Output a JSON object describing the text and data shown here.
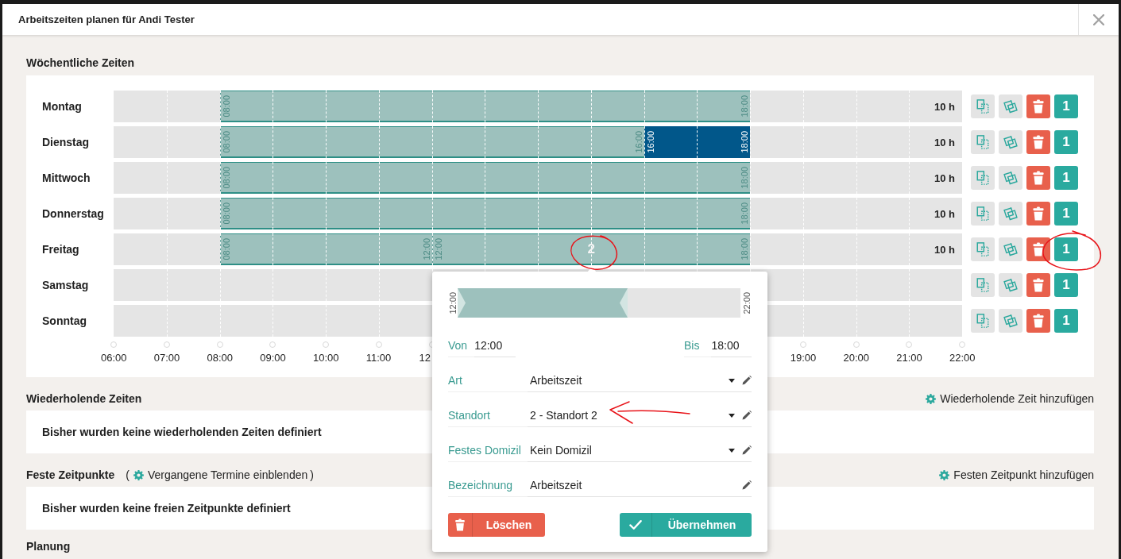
{
  "dialog": {
    "title": "Arbeitszeiten planen für Andi Tester"
  },
  "weekly": {
    "title": "Wöchentliche Zeiten",
    "days": [
      {
        "name": "Montag",
        "total": "10 h",
        "count": "1",
        "segments": [
          {
            "start": "08:00",
            "end": "18:00",
            "color": "#9dc1bd"
          }
        ]
      },
      {
        "name": "Dienstag",
        "total": "10 h",
        "count": "1",
        "segments": [
          {
            "start": "08:00",
            "end": "16:00",
            "color": "#9dc1bd"
          },
          {
            "start": "16:00",
            "end": "18:00",
            "color": "#01578a"
          }
        ]
      },
      {
        "name": "Mittwoch",
        "total": "10 h",
        "count": "1",
        "segments": [
          {
            "start": "08:00",
            "end": "18:00",
            "color": "#9dc1bd"
          }
        ]
      },
      {
        "name": "Donnerstag",
        "total": "10 h",
        "count": "1",
        "segments": [
          {
            "start": "08:00",
            "end": "18:00",
            "color": "#9dc1bd"
          }
        ]
      },
      {
        "name": "Freitag",
        "total": "10 h",
        "count": "1",
        "segments": [
          {
            "start": "08:00",
            "end": "12:00",
            "color": "#9dc1bd"
          },
          {
            "start": "12:00",
            "end": "18:00",
            "color": "#9dc1bd",
            "badge": "2"
          }
        ]
      },
      {
        "name": "Samstag",
        "count": "1"
      },
      {
        "name": "Sonntag",
        "count": "1"
      }
    ],
    "axis": [
      "06:00",
      "07:00",
      "08:00",
      "09:00",
      "10:00",
      "11:00",
      "12",
      "19:00",
      "20:00",
      "21:00",
      "22:00"
    ]
  },
  "popup": {
    "range": {
      "start": "12:00",
      "end": "22:00",
      "level": 0.6
    },
    "from": {
      "label": "Von",
      "value": "12:00"
    },
    "to": {
      "label": "Bis",
      "value": "18:00"
    },
    "fields": [
      {
        "label": "Art",
        "value": "Arbeitszeit",
        "kind": "select"
      },
      {
        "label": "Standort",
        "value": "2 - Standort 2",
        "kind": "select"
      },
      {
        "label": "Festes Domizil",
        "value": "Kein Domizil",
        "kind": "select"
      },
      {
        "label": "Bezeichnung",
        "value": "Arbeitszeit",
        "kind": "text"
      }
    ],
    "buttons": [
      {
        "label": "Löschen",
        "kind": "delete"
      },
      {
        "label": "Übernehmen",
        "kind": "confirm"
      }
    ]
  },
  "sections": [
    {
      "title": "Wiederholende Zeiten",
      "action": "Wiederholende Zeit hinzufügen",
      "empty_text": "Bisher wurden keine wiederholenden Zeiten definiert"
    },
    {
      "title": "Feste Zeitpunkte",
      "toggle": {
        "open": "(",
        "label": "Vergangene Termine einblenden",
        "close": ")"
      },
      "action": "Festen Zeitpunkt hinzufügen",
      "empty_text": "Bisher wurden keine freien Zeitpunkte definiert"
    },
    {
      "title": "Planung"
    }
  ]
}
